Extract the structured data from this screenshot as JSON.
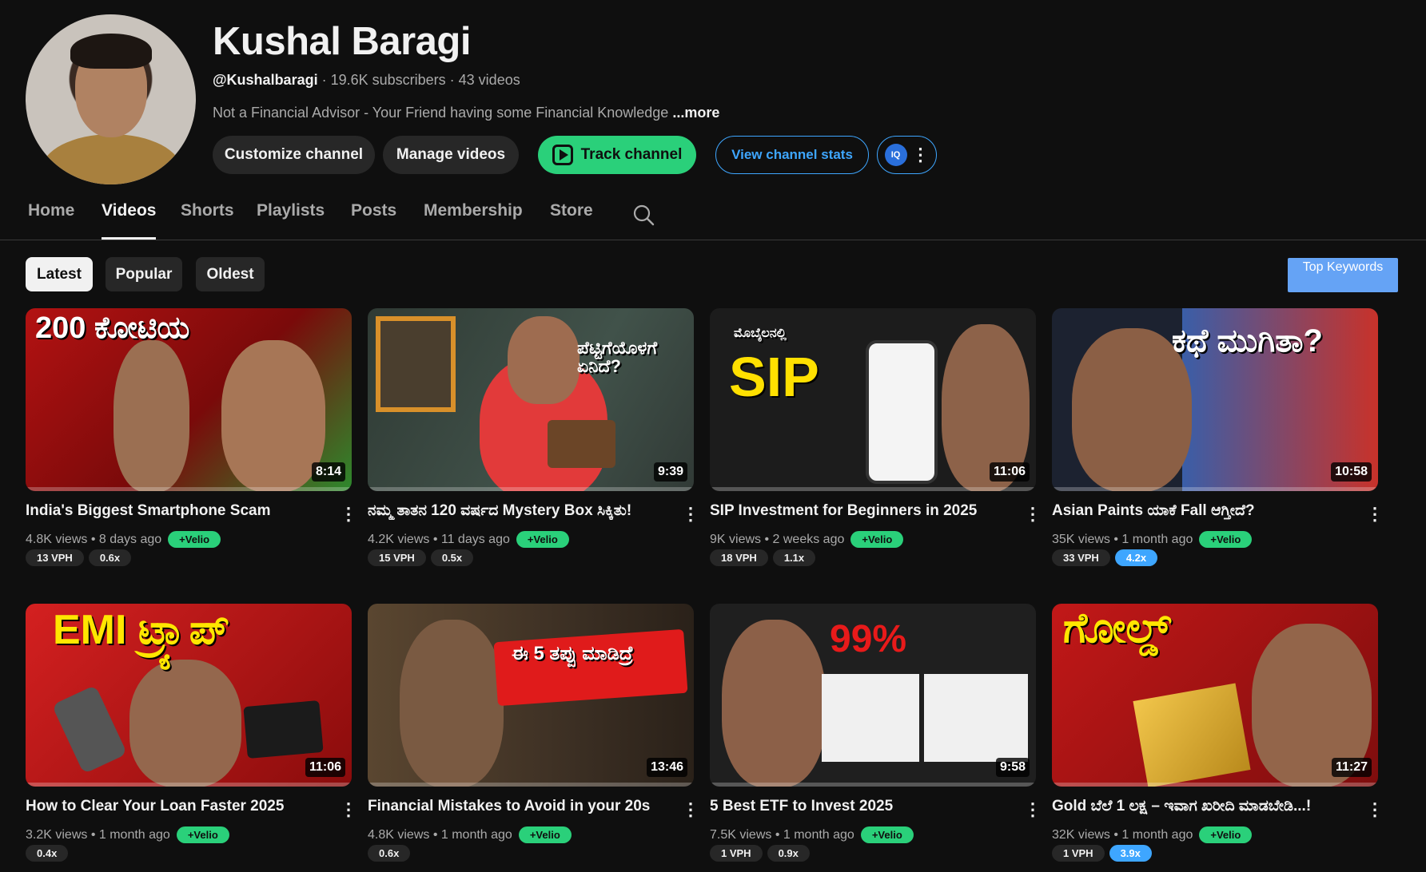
{
  "channel": {
    "name": "Kushal Baragi",
    "handle": "@Kushalbaragi",
    "meta": " · 19.6K subscribers · 43 videos",
    "description": "Not a Financial Advisor - Your Friend having some Financial Knowledge ",
    "more": "...more"
  },
  "actions": {
    "customize": "Customize channel",
    "manage": "Manage videos",
    "track": "Track channel",
    "stats": "View channel stats",
    "iq": "IQ"
  },
  "tabs": [
    "Home",
    "Videos",
    "Shorts",
    "Playlists",
    "Posts",
    "Membership",
    "Store"
  ],
  "chips": [
    "Latest",
    "Popular",
    "Oldest"
  ],
  "top_keywords": "Top Keywords",
  "videos": [
    {
      "title": "India's Biggest Smartphone Scam",
      "views": "4.8K views",
      "age": "8 days ago",
      "duration": "8:14",
      "vph": "13 VPH",
      "ratio": "0.6x",
      "velio": "+Velio",
      "thumb_text": "200 ಕೋಟಿಯ"
    },
    {
      "title": "ನಮ್ಮ ತಾತನ 120 ವರ್ಷದ Mystery Box ಸಿಕ್ಕಿತು!",
      "views": "4.2K views",
      "age": "11 days ago",
      "duration": "9:39",
      "vph": "15 VPH",
      "ratio": "0.5x",
      "velio": "+Velio",
      "thumb_text": "ಪೆಟ್ಟಿಗೆಯೊಳಗೆ ಏನಿದೆ?"
    },
    {
      "title": "SIP Investment for Beginners in 2025",
      "views": "9K views",
      "age": "2 weeks ago",
      "duration": "11:06",
      "vph": "18 VPH",
      "ratio": "1.1x",
      "velio": "+Velio",
      "thumb_text": "SIP"
    },
    {
      "title": "Asian Paints ಯಾಕೆ Fall ಆಗ್ತೀದೆ?",
      "views": "35K views",
      "age": "1 month ago",
      "duration": "10:58",
      "vph": "33 VPH",
      "ratio": "4.2x",
      "velio": "+Velio",
      "thumb_text": "ಕಥೆ ಮುಗಿತಾ?"
    },
    {
      "title": "How to Clear Your Loan Faster 2025",
      "views": "3.2K views",
      "age": "1 month ago",
      "duration": "11:06",
      "vph": "",
      "ratio": "0.4x",
      "velio": "+Velio",
      "thumb_text": "EMI ಟ್ರ್ಯಾಪ್"
    },
    {
      "title": "Financial Mistakes to Avoid in your 20s",
      "views": "4.8K views",
      "age": "1 month ago",
      "duration": "13:46",
      "vph": "",
      "ratio": "0.6x",
      "velio": "+Velio",
      "thumb_text": "ಈ 5 ತಪ್ಪು ಮಾಡಿದ್ರೆ"
    },
    {
      "title": "5 Best ETF to Invest 2025",
      "views": "7.5K views",
      "age": "1 month ago",
      "duration": "9:58",
      "vph": "1 VPH",
      "ratio": "0.9x",
      "velio": "+Velio",
      "thumb_text": "99%"
    },
    {
      "title": "Gold ಬೆಲೆ 1 ಲಕ್ಷ – ಇವಾಗ ಖರೀದಿ ಮಾಡಬೇಡಿ...!",
      "views": "32K views",
      "age": "1 month ago",
      "duration": "11:27",
      "vph": "1 VPH",
      "ratio": "3.9x",
      "velio": "+Velio",
      "thumb_text": "ಗೋಲ್ಡ್"
    }
  ],
  "colors": {
    "accent_green": "#2ad07a",
    "accent_blue": "#3ea6ff",
    "background": "#0f0f0f"
  }
}
